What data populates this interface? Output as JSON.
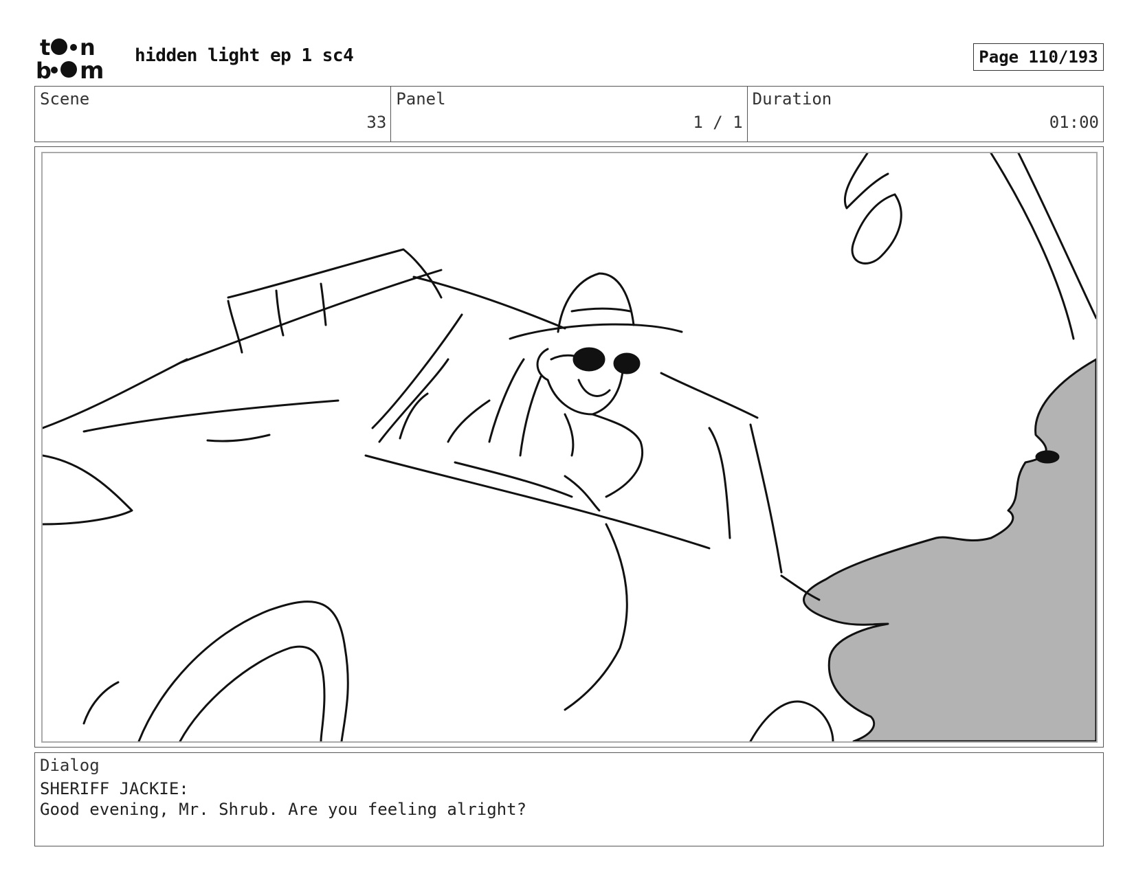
{
  "header": {
    "logo_text": "toon boom",
    "title": "hidden light ep 1 sc4",
    "page_label": "Page 110/193"
  },
  "info": {
    "scene_label": "Scene",
    "scene_value": "33",
    "panel_label": "Panel",
    "panel_value": "1 / 1",
    "duration_label": "Duration",
    "duration_value": "01:00"
  },
  "dialog": {
    "label": "Dialog",
    "speaker": "SHERIFF JACKIE:",
    "line": "Good evening, Mr. Shrub. Are you feeling alright?"
  }
}
